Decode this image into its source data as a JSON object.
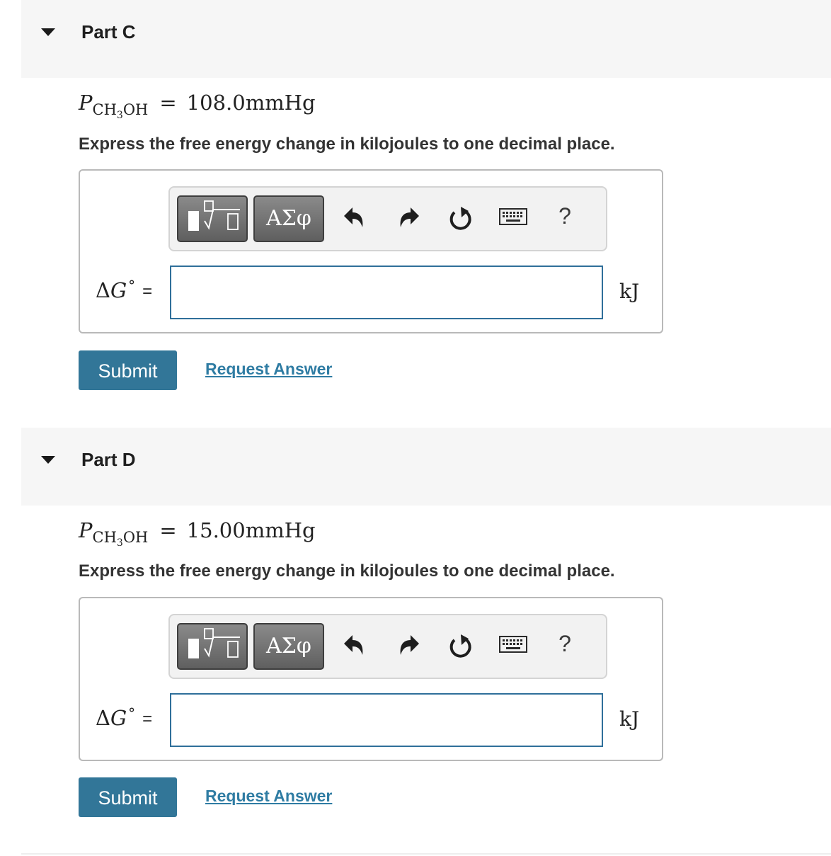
{
  "parts": [
    {
      "title": "Part C",
      "formula": {
        "variable": "P",
        "subscript_main": "CH",
        "subscript_digit": "3",
        "subscript_tail": "OH",
        "equals": "=",
        "value": "108.0mmHg"
      },
      "instruction": "Express the free energy change in kilojoules to one decimal place.",
      "toolbar": {
        "templates_icon": "templates-icon",
        "symbols_label": "ΑΣφ",
        "undo_icon": "undo-icon",
        "redo_icon": "redo-icon",
        "reset_icon": "reset-icon",
        "keyboard_icon": "keyboard-icon",
        "help_label": "?"
      },
      "answer": {
        "lhs_delta": "Δ",
        "lhs_var": "G",
        "lhs_degree": "°",
        "lhs_equals": "=",
        "value": "",
        "unit": "kJ"
      },
      "submit_label": "Submit",
      "request_label": "Request Answer"
    },
    {
      "title": "Part D",
      "formula": {
        "variable": "P",
        "subscript_main": "CH",
        "subscript_digit": "3",
        "subscript_tail": "OH",
        "equals": "=",
        "value": "15.00mmHg"
      },
      "instruction": "Express the free energy change in kilojoules to one decimal place.",
      "toolbar": {
        "templates_icon": "templates-icon",
        "symbols_label": "ΑΣφ",
        "undo_icon": "undo-icon",
        "redo_icon": "redo-icon",
        "reset_icon": "reset-icon",
        "keyboard_icon": "keyboard-icon",
        "help_label": "?"
      },
      "answer": {
        "lhs_delta": "Δ",
        "lhs_var": "G",
        "lhs_degree": "°",
        "lhs_equals": "=",
        "value": "",
        "unit": "kJ"
      },
      "submit_label": "Submit",
      "request_label": "Request Answer"
    }
  ],
  "colors": {
    "header_bg": "#f6f6f6",
    "submit_bg": "#327698",
    "link": "#2f7ca3",
    "input_border": "#2f6f9a"
  }
}
